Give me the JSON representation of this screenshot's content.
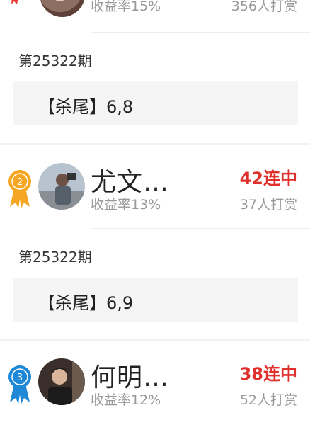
{
  "top_card": {
    "rate": "收益率15%",
    "reward": "356人打赏"
  },
  "predictions": [
    {
      "period": "第25322期",
      "label": "【杀尾】6,8"
    },
    {
      "period": "第25322期",
      "label": "【杀尾】6,9"
    }
  ],
  "cards": [
    {
      "rank": "2",
      "name": "尤文…",
      "rate": "收益率13%",
      "streak": "42连中",
      "reward": "37人打赏",
      "medal_color": "#f5a623"
    },
    {
      "rank": "3",
      "name": "何明…",
      "rate": "收益率12%",
      "streak": "38连中",
      "reward": "52人打赏",
      "medal_color": "#1e88d6"
    }
  ],
  "colors": {
    "accent_red": "#e0302c",
    "muted": "#999999",
    "panel": "#f5f5f5"
  }
}
